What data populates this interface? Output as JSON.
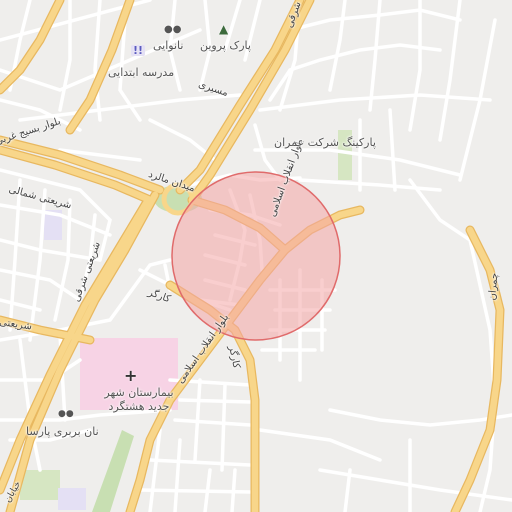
{
  "labels": {
    "boulevard_enghelab": "بلوار انقلاب اسلامی",
    "boulevard_enghelab_south": "بلوار انقلاب اسلامی",
    "boulevard_basij": "بلوار بسیج غربی",
    "midan_mallard": "میدان مالرد",
    "kargar": "کارگر",
    "kargar_south": "کارگر",
    "shariati_shomali": "شریعتی شمالی",
    "shariati_sharghi": "شریعتی شرقی",
    "shariati": "شریعتی",
    "masiri": "مسیری",
    "shargi_top": "شرقی",
    "shargi_bottom": "خیابان",
    "chamran": "چمران"
  },
  "pois": {
    "park_parvin": "پارک پروین",
    "nanvaei": "نانوایی",
    "madrese": "مدرسه ابتدایی",
    "parking": "پارکینگ شرکت عمران",
    "hospital": "بیمارستان شهر جدید هشتگرد",
    "nan_barbari": "نان بربری پارسا"
  },
  "icons": {
    "park": "tree-icon",
    "bakery": "bread-icon",
    "school": "school-icon",
    "hospital": "hospital-cross-icon"
  },
  "colors": {
    "background": "#efeeec",
    "major_road": "#f8d68a",
    "major_road_casing": "#e8b860",
    "minor_road": "#ffffff",
    "park": "#c8dfb2",
    "hospital_area": "#f7d3e5",
    "circle_fill": "#f4a6a6",
    "circle_stroke": "#e06b6b"
  }
}
